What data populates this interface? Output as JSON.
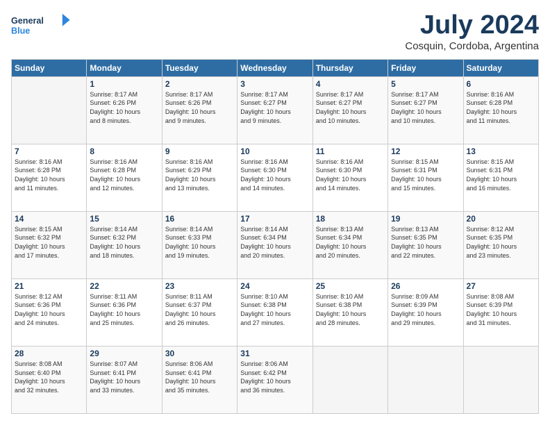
{
  "header": {
    "logo_line1": "General",
    "logo_line2": "Blue",
    "month_title": "July 2024",
    "location": "Cosquin, Cordoba, Argentina"
  },
  "weekdays": [
    "Sunday",
    "Monday",
    "Tuesday",
    "Wednesday",
    "Thursday",
    "Friday",
    "Saturday"
  ],
  "weeks": [
    [
      {
        "day": "",
        "content": ""
      },
      {
        "day": "1",
        "content": "Sunrise: 8:17 AM\nSunset: 6:26 PM\nDaylight: 10 hours\nand 8 minutes."
      },
      {
        "day": "2",
        "content": "Sunrise: 8:17 AM\nSunset: 6:26 PM\nDaylight: 10 hours\nand 9 minutes."
      },
      {
        "day": "3",
        "content": "Sunrise: 8:17 AM\nSunset: 6:27 PM\nDaylight: 10 hours\nand 9 minutes."
      },
      {
        "day": "4",
        "content": "Sunrise: 8:17 AM\nSunset: 6:27 PM\nDaylight: 10 hours\nand 10 minutes."
      },
      {
        "day": "5",
        "content": "Sunrise: 8:17 AM\nSunset: 6:27 PM\nDaylight: 10 hours\nand 10 minutes."
      },
      {
        "day": "6",
        "content": "Sunrise: 8:16 AM\nSunset: 6:28 PM\nDaylight: 10 hours\nand 11 minutes."
      }
    ],
    [
      {
        "day": "7",
        "content": "Sunrise: 8:16 AM\nSunset: 6:28 PM\nDaylight: 10 hours\nand 11 minutes."
      },
      {
        "day": "8",
        "content": "Sunrise: 8:16 AM\nSunset: 6:28 PM\nDaylight: 10 hours\nand 12 minutes."
      },
      {
        "day": "9",
        "content": "Sunrise: 8:16 AM\nSunset: 6:29 PM\nDaylight: 10 hours\nand 13 minutes."
      },
      {
        "day": "10",
        "content": "Sunrise: 8:16 AM\nSunset: 6:30 PM\nDaylight: 10 hours\nand 14 minutes."
      },
      {
        "day": "11",
        "content": "Sunrise: 8:16 AM\nSunset: 6:30 PM\nDaylight: 10 hours\nand 14 minutes."
      },
      {
        "day": "12",
        "content": "Sunrise: 8:15 AM\nSunset: 6:31 PM\nDaylight: 10 hours\nand 15 minutes."
      },
      {
        "day": "13",
        "content": "Sunrise: 8:15 AM\nSunset: 6:31 PM\nDaylight: 10 hours\nand 16 minutes."
      }
    ],
    [
      {
        "day": "14",
        "content": "Sunrise: 8:15 AM\nSunset: 6:32 PM\nDaylight: 10 hours\nand 17 minutes."
      },
      {
        "day": "15",
        "content": "Sunrise: 8:14 AM\nSunset: 6:32 PM\nDaylight: 10 hours\nand 18 minutes."
      },
      {
        "day": "16",
        "content": "Sunrise: 8:14 AM\nSunset: 6:33 PM\nDaylight: 10 hours\nand 19 minutes."
      },
      {
        "day": "17",
        "content": "Sunrise: 8:14 AM\nSunset: 6:34 PM\nDaylight: 10 hours\nand 20 minutes."
      },
      {
        "day": "18",
        "content": "Sunrise: 8:13 AM\nSunset: 6:34 PM\nDaylight: 10 hours\nand 20 minutes."
      },
      {
        "day": "19",
        "content": "Sunrise: 8:13 AM\nSunset: 6:35 PM\nDaylight: 10 hours\nand 22 minutes."
      },
      {
        "day": "20",
        "content": "Sunrise: 8:12 AM\nSunset: 6:35 PM\nDaylight: 10 hours\nand 23 minutes."
      }
    ],
    [
      {
        "day": "21",
        "content": "Sunrise: 8:12 AM\nSunset: 6:36 PM\nDaylight: 10 hours\nand 24 minutes."
      },
      {
        "day": "22",
        "content": "Sunrise: 8:11 AM\nSunset: 6:36 PM\nDaylight: 10 hours\nand 25 minutes."
      },
      {
        "day": "23",
        "content": "Sunrise: 8:11 AM\nSunset: 6:37 PM\nDaylight: 10 hours\nand 26 minutes."
      },
      {
        "day": "24",
        "content": "Sunrise: 8:10 AM\nSunset: 6:38 PM\nDaylight: 10 hours\nand 27 minutes."
      },
      {
        "day": "25",
        "content": "Sunrise: 8:10 AM\nSunset: 6:38 PM\nDaylight: 10 hours\nand 28 minutes."
      },
      {
        "day": "26",
        "content": "Sunrise: 8:09 AM\nSunset: 6:39 PM\nDaylight: 10 hours\nand 29 minutes."
      },
      {
        "day": "27",
        "content": "Sunrise: 8:08 AM\nSunset: 6:39 PM\nDaylight: 10 hours\nand 31 minutes."
      }
    ],
    [
      {
        "day": "28",
        "content": "Sunrise: 8:08 AM\nSunset: 6:40 PM\nDaylight: 10 hours\nand 32 minutes."
      },
      {
        "day": "29",
        "content": "Sunrise: 8:07 AM\nSunset: 6:41 PM\nDaylight: 10 hours\nand 33 minutes."
      },
      {
        "day": "30",
        "content": "Sunrise: 8:06 AM\nSunset: 6:41 PM\nDaylight: 10 hours\nand 35 minutes."
      },
      {
        "day": "31",
        "content": "Sunrise: 8:06 AM\nSunset: 6:42 PM\nDaylight: 10 hours\nand 36 minutes."
      },
      {
        "day": "",
        "content": ""
      },
      {
        "day": "",
        "content": ""
      },
      {
        "day": "",
        "content": ""
      }
    ]
  ]
}
